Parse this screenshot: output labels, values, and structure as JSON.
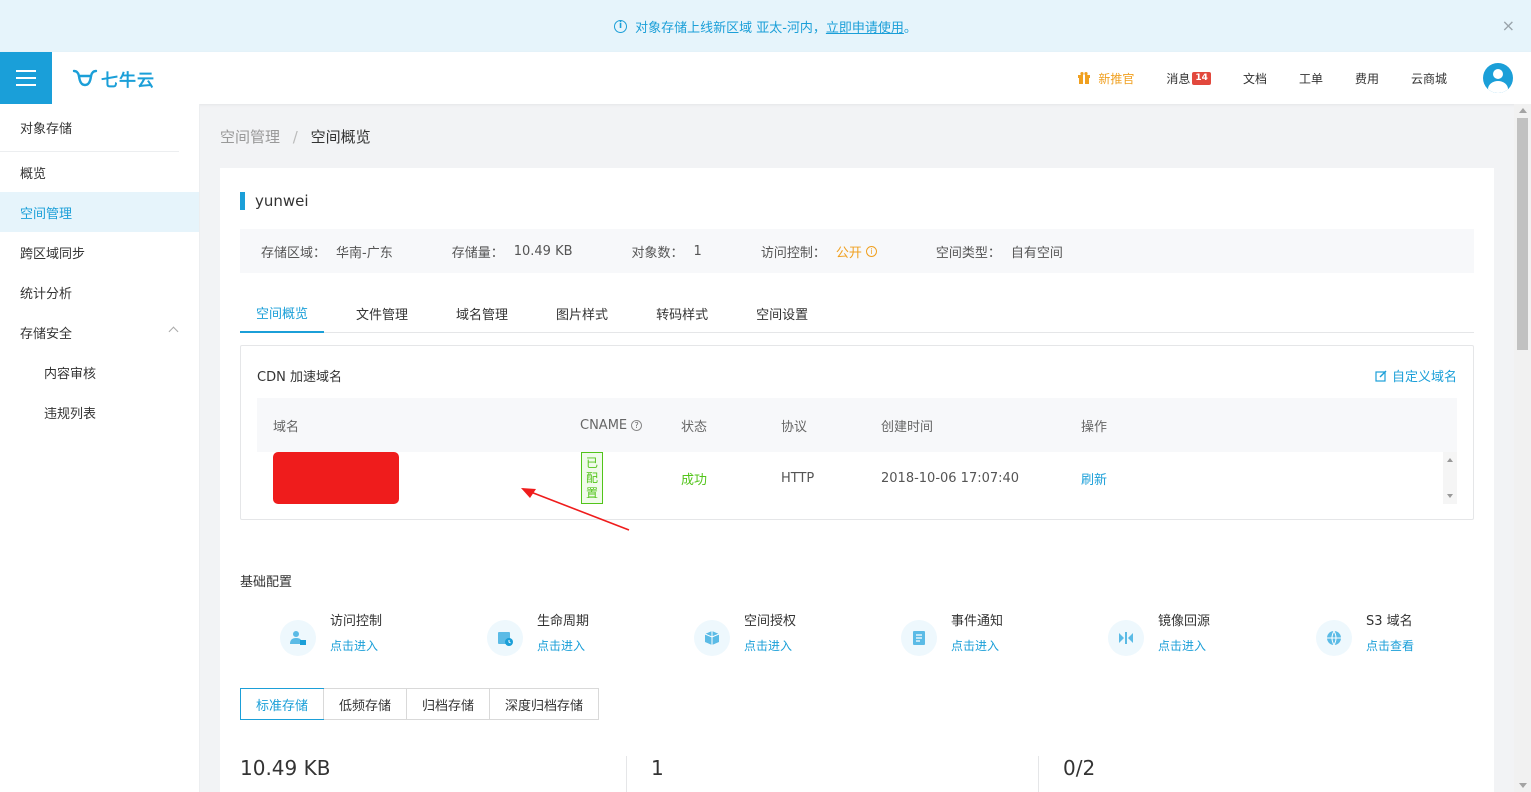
{
  "banner": {
    "text": "对象存储上线新区域 亚太-河内，",
    "link": "立即申请使用",
    "tail": "。",
    "close": "×"
  },
  "header": {
    "brand": "七牛云",
    "nav": {
      "gift": "新推官",
      "messages": "消息",
      "messages_badge": "14",
      "docs": "文档",
      "tickets": "工单",
      "billing": "费用",
      "mall": "云商城"
    }
  },
  "sidebar": {
    "title": "对象存储",
    "items": [
      "概览",
      "空间管理",
      "跨区域同步",
      "统计分析",
      "存储安全"
    ],
    "sub_items": [
      "内容审核",
      "违规列表"
    ]
  },
  "breadcrumb": {
    "parent": "空间管理",
    "sep": "/",
    "current": "空间概览"
  },
  "bucket": {
    "name": "yunwei",
    "region_label": "存储区域：",
    "region": "华南-广东",
    "size_label": "存储量：",
    "size": "10.49 KB",
    "count_label": "对象数：",
    "count": "1",
    "access_label": "访问控制：",
    "access": "公开",
    "type_label": "空间类型：",
    "type": "自有空间"
  },
  "tabs": [
    "空间概览",
    "文件管理",
    "域名管理",
    "图片样式",
    "转码样式",
    "空间设置"
  ],
  "cdn": {
    "title": "CDN 加速域名",
    "custom_link": "自定义域名",
    "columns": [
      "域名",
      "CNAME",
      "状态",
      "协议",
      "创建时间",
      "操作"
    ],
    "row": {
      "cname_tag": "已配置",
      "status": "成功",
      "protocol": "HTTP",
      "created": "2018-10-06 17:07:40",
      "action": "刷新"
    }
  },
  "basic": {
    "title": "基础配置",
    "features": [
      {
        "name": "访问控制",
        "action": "点击进入",
        "icon": "access-control-icon"
      },
      {
        "name": "生命周期",
        "action": "点击进入",
        "icon": "lifecycle-icon"
      },
      {
        "name": "空间授权",
        "action": "点击进入",
        "icon": "space-auth-icon"
      },
      {
        "name": "事件通知",
        "action": "点击进入",
        "icon": "event-notify-icon"
      },
      {
        "name": "镜像回源",
        "action": "点击进入",
        "icon": "mirror-origin-icon"
      },
      {
        "name": "S3 域名",
        "action": "点击查看",
        "icon": "globe-icon"
      }
    ]
  },
  "storage_tabs": [
    "标准存储",
    "低频存储",
    "归档存储",
    "深度归档存储"
  ],
  "stats": [
    "10.49 KB",
    "1",
    "0/2"
  ],
  "colors": {
    "accent": "#1b9fd8",
    "warning": "#f0a020",
    "success": "#52c41a",
    "danger": "#e2483d"
  }
}
